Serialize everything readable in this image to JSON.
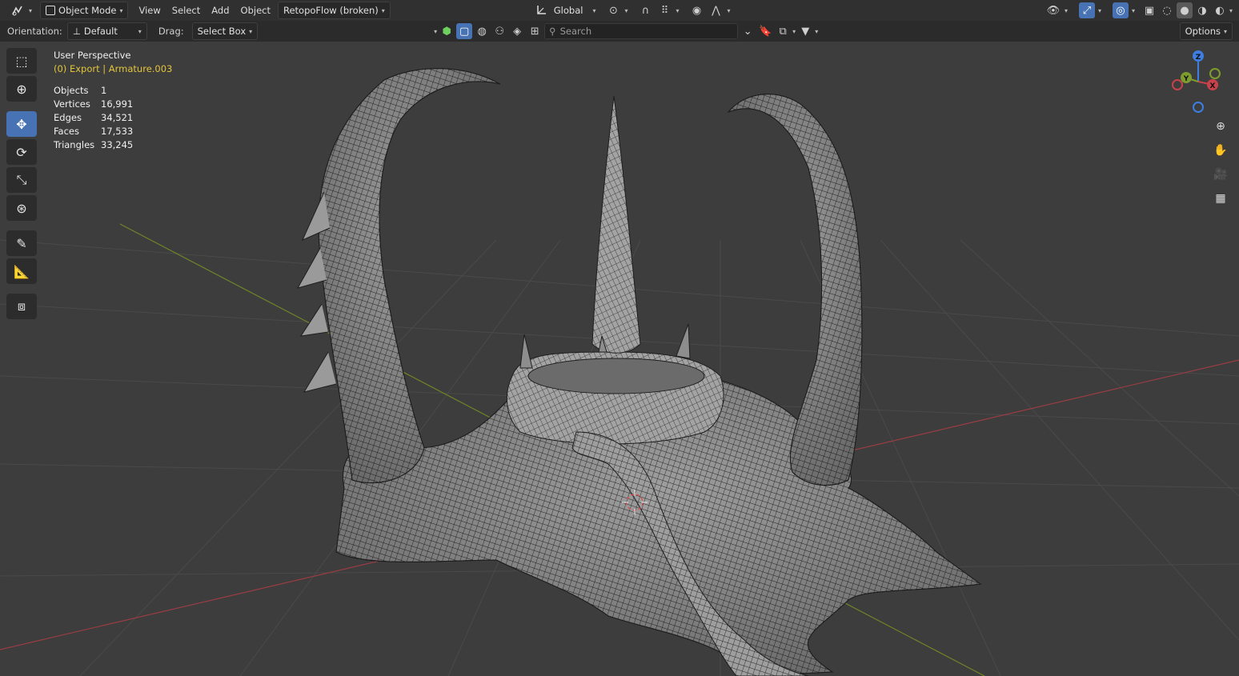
{
  "header": {
    "editor_icon": "editor-type-icon",
    "mode": "Object Mode",
    "menus": [
      "View",
      "Select",
      "Add",
      "Object"
    ],
    "addon_menu": "RetopoFlow (broken)",
    "transform_orientation": "Global"
  },
  "tool_header": {
    "orientation_label": "Orientation:",
    "orientation_value": "Default",
    "drag_label": "Drag:",
    "drag_value": "Select Box",
    "search_placeholder": "Search",
    "options_label": "Options"
  },
  "viewport": {
    "title": "User Perspective",
    "context_prefix": "(0) Export | ",
    "context_object": "Armature.003",
    "stats": [
      {
        "label": "Objects",
        "value": "1"
      },
      {
        "label": "Vertices",
        "value": "16,991"
      },
      {
        "label": "Edges",
        "value": "34,521"
      },
      {
        "label": "Faces",
        "value": "17,533"
      },
      {
        "label": "Triangles",
        "value": "33,245"
      }
    ]
  },
  "gizmo": {
    "x": "X",
    "y": "Y",
    "z": "Z"
  },
  "colors": {
    "accent": "#4772b3",
    "context_text": "#e3c53c",
    "axis_x": "#c7424a",
    "axis_y": "#7d9d2c",
    "axis_z": "#3d7ee0",
    "viewport_bg": "#3d3d3d"
  }
}
